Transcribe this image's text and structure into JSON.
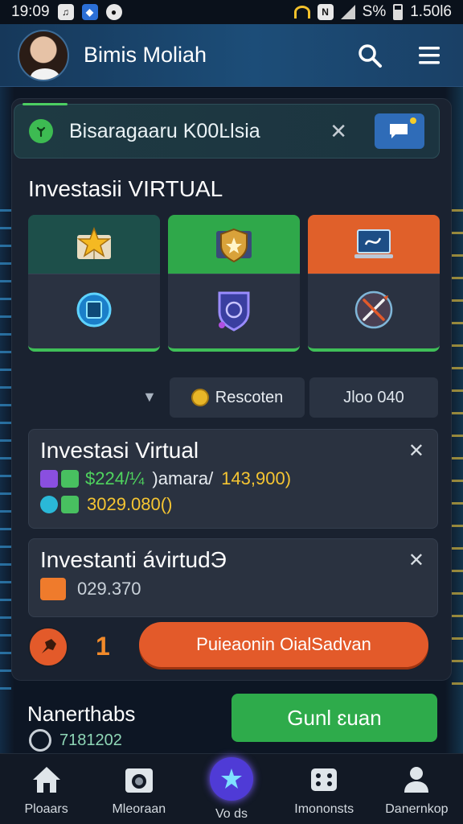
{
  "status_bar": {
    "time": "19:09",
    "battery_percent": "S%",
    "speed": "1.50l6",
    "icons": [
      "music-note-icon",
      "shield-app-icon",
      "chat-app-icon",
      "wifi-icon",
      "n-app-icon",
      "signal-icon",
      "battery-icon"
    ]
  },
  "header": {
    "user_name": "Bimis Moliah",
    "search_icon": "search-icon",
    "menu_icon": "hamburger-menu-icon"
  },
  "banner": {
    "text": "Bisaragaaru K00Ŀlsia",
    "close": "✕"
  },
  "section": {
    "title": "Investasii VIRTUAL"
  },
  "tiles": [
    {
      "top_icon": "star-book-icon",
      "bottom_icon": "target-book-icon",
      "top_color": "#1d4f4a"
    },
    {
      "top_icon": "shield-badge-icon",
      "bottom_icon": "crest-shield-icon",
      "top_color": "#2fa84a"
    },
    {
      "top_icon": "laptop-chart-icon",
      "bottom_icon": "crossed-swords-icon",
      "top_color": "#e0602a"
    }
  ],
  "filter": {
    "button_label": "Rescoten",
    "value": "Jloo 040"
  },
  "card1": {
    "title": "Investasi Virtual",
    "line1_green": "$224/¼",
    "line1_white": ")amara/",
    "line1_yellow": "143,900)",
    "line2_yellow": "3029.080()"
  },
  "card2": {
    "title": "Investanti ávirtudЭ",
    "value": "029.370"
  },
  "action": {
    "count": "1",
    "button_label": "Puieaonin OialSadvan"
  },
  "footer": {
    "label": "Nanerthabs",
    "sub_value": "7181202",
    "button_label": "Gunl ɛuan"
  },
  "nav": [
    {
      "label": "Ploaars",
      "icon": "home-icon"
    },
    {
      "label": "Mleoraan",
      "icon": "camera-icon"
    },
    {
      "label": "Vo ds",
      "icon": "star-burst-icon"
    },
    {
      "label": "Imononsts",
      "icon": "dice-icon"
    },
    {
      "label": "Danernkop",
      "icon": "user-icon"
    }
  ],
  "colors": {
    "accent_green": "#2eab4b",
    "accent_orange": "#e35a2a",
    "header_blue": "#1c4d78",
    "nav_purple": "#4f3bd6"
  }
}
